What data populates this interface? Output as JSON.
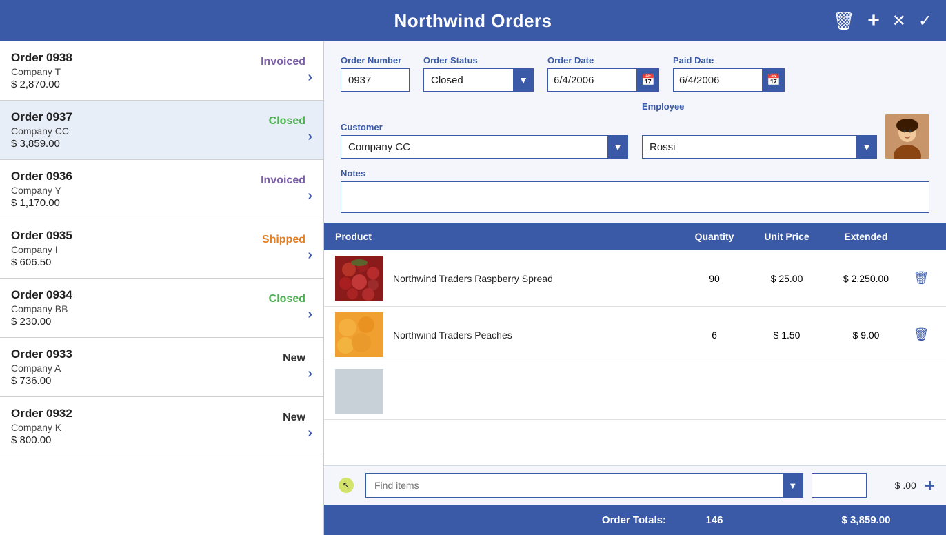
{
  "app": {
    "title": "Northwind Orders",
    "icons": {
      "delete": "🗑",
      "add": "+",
      "close": "✕",
      "confirm": "✓"
    }
  },
  "orders": [
    {
      "id": "0938",
      "company": "Company T",
      "amount": "$ 2,870.00",
      "status": "Invoiced",
      "statusClass": "status-invoiced"
    },
    {
      "id": "0937",
      "company": "Company CC",
      "amount": "$ 3,859.00",
      "status": "Closed",
      "statusClass": "status-closed"
    },
    {
      "id": "0936",
      "company": "Company Y",
      "amount": "$ 1,170.00",
      "status": "Invoiced",
      "statusClass": "status-invoiced"
    },
    {
      "id": "0935",
      "company": "Company I",
      "amount": "$ 606.50",
      "status": "Shipped",
      "statusClass": "status-shipped"
    },
    {
      "id": "0934",
      "company": "Company BB",
      "amount": "$ 230.00",
      "status": "Closed",
      "statusClass": "status-closed"
    },
    {
      "id": "0933",
      "company": "Company A",
      "amount": "$ 736.00",
      "status": "New",
      "statusClass": "status-new"
    },
    {
      "id": "0932",
      "company": "Company K",
      "amount": "$ 800.00",
      "status": "New",
      "statusClass": "status-new"
    }
  ],
  "detail": {
    "order_number_label": "Order Number",
    "order_number_value": "0937",
    "order_status_label": "Order Status",
    "order_status_value": "Closed",
    "order_date_label": "Order Date",
    "order_date_value": "6/4/2006",
    "paid_date_label": "Paid Date",
    "paid_date_value": "6/4/2006",
    "customer_label": "Customer",
    "customer_value": "Company CC",
    "employee_label": "Employee",
    "employee_value": "Rossi",
    "notes_label": "Notes",
    "notes_value": ""
  },
  "table": {
    "headers": {
      "product": "Product",
      "quantity": "Quantity",
      "unit_price": "Unit Price",
      "extended": "Extended"
    },
    "rows": [
      {
        "name": "Northwind Traders Raspberry Spread",
        "qty": "90",
        "unit": "$ 25.00",
        "ext": "$ 2,250.00",
        "img": "raspberry"
      },
      {
        "name": "Northwind Traders Peaches",
        "qty": "6",
        "unit": "$ 1.50",
        "ext": "$ 9.00",
        "img": "peaches"
      },
      {
        "name": "",
        "qty": "",
        "unit": "",
        "ext": "",
        "img": "placeholder"
      }
    ]
  },
  "add_row": {
    "find_placeholder": "Find items",
    "qty_value": "",
    "price": "$ .00",
    "add_label": "+"
  },
  "totals": {
    "label": "Order Totals:",
    "qty": "146",
    "ext": "$ 3,859.00"
  }
}
